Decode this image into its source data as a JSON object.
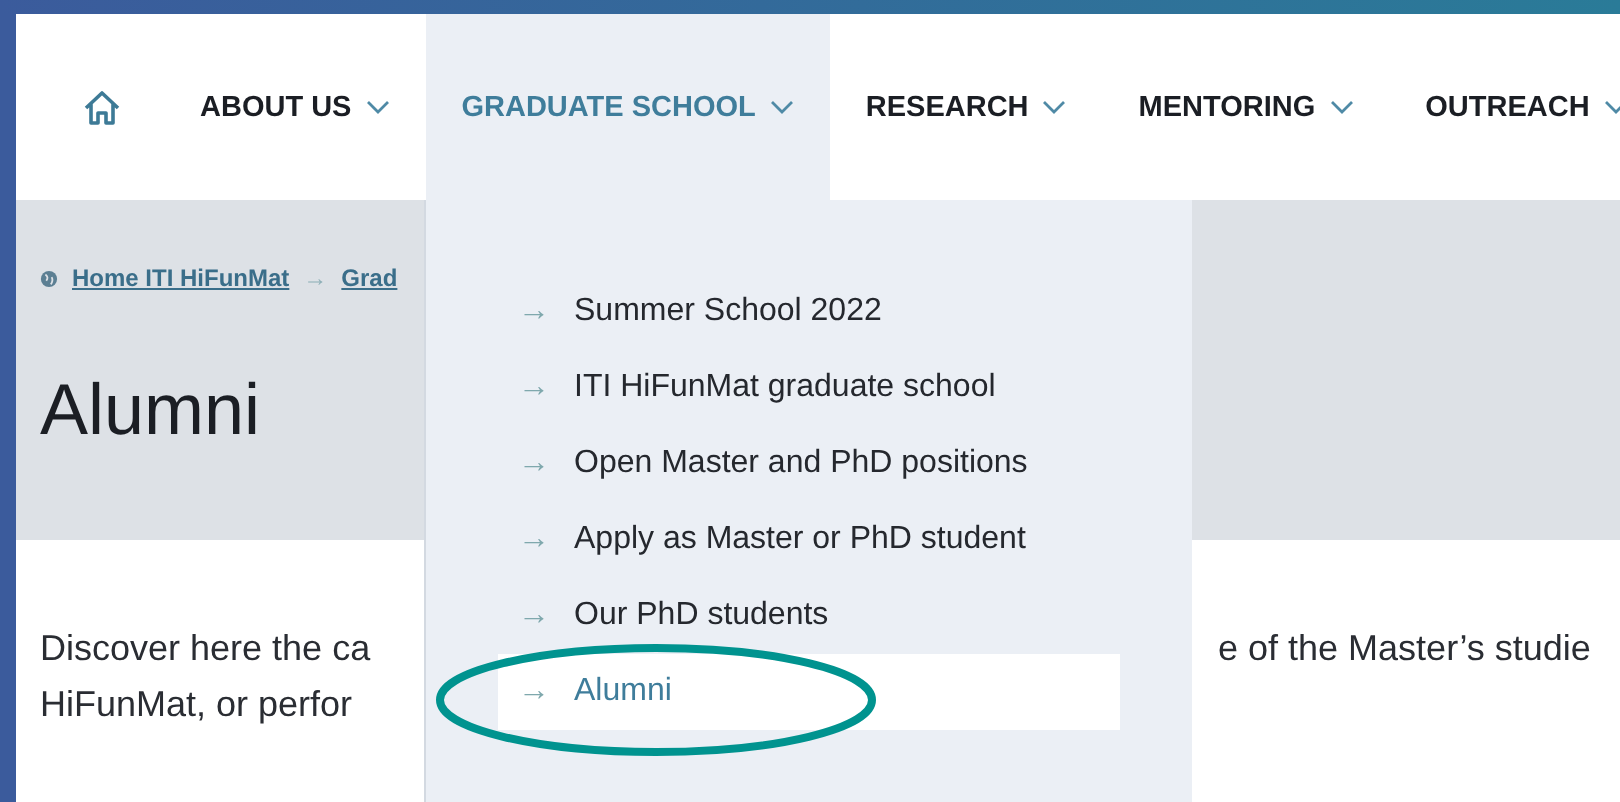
{
  "nav": {
    "items": [
      {
        "label": "ABOUT US",
        "selected": false
      },
      {
        "label": "GRADUATE SCHOOL",
        "selected": true
      },
      {
        "label": "RESEARCH",
        "selected": false
      },
      {
        "label": "MENTORING",
        "selected": false
      },
      {
        "label": "OUTREACH",
        "selected": false
      }
    ]
  },
  "breadcrumb": {
    "items": [
      "Home ITI HiFunMat",
      "Grad"
    ],
    "separator": "→"
  },
  "title": "Alumni",
  "intro": {
    "line_1_start": "Discover here the ca",
    "line_1_end": "e of the Master’s studie",
    "line_2_start": "HiFunMat, or perfor"
  },
  "dropdown": {
    "arrow": "→",
    "items": [
      {
        "label": "Summer School 2022",
        "selected": false
      },
      {
        "label": "ITI HiFunMat graduate school",
        "selected": false
      },
      {
        "label": "Open Master and PhD positions",
        "selected": false
      },
      {
        "label": "Apply as Master or PhD student",
        "selected": false
      },
      {
        "label": "Our PhD students",
        "selected": false
      },
      {
        "label": "Alumni",
        "selected": true
      }
    ]
  }
}
